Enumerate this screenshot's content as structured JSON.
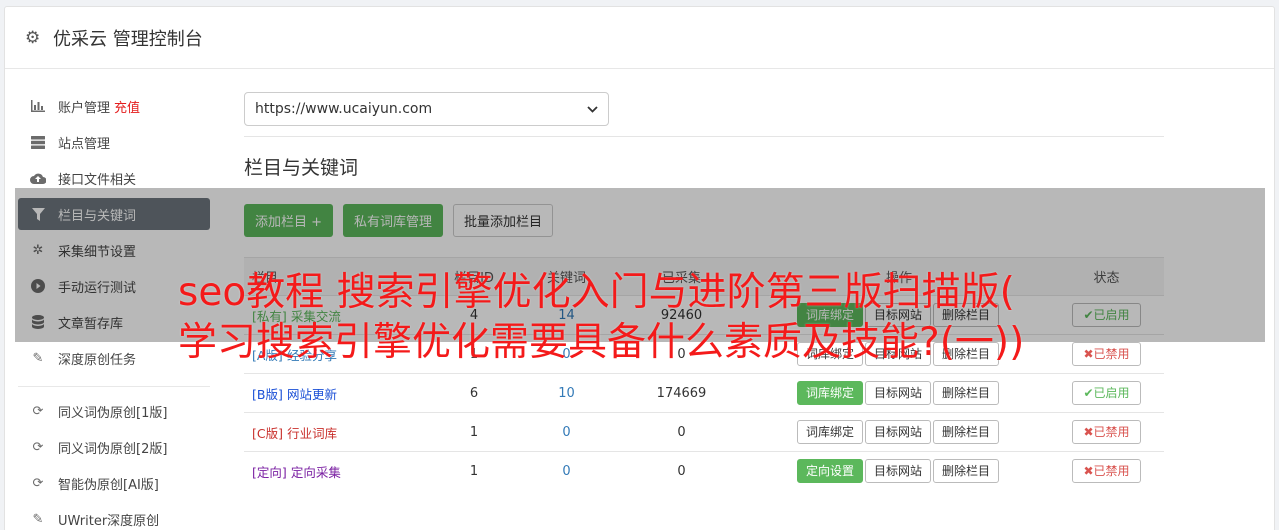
{
  "header": {
    "title": "优采云 管理控制台",
    "icon": "gear-icon"
  },
  "sidebar": {
    "items": [
      {
        "label": "账户管理",
        "extra": "充值",
        "icon": "bar-chart-icon"
      },
      {
        "label": "站点管理",
        "icon": "server-icon"
      },
      {
        "label": "接口文件相关",
        "icon": "cloud-upload-icon"
      },
      {
        "label": "栏目与关键词",
        "icon": "filter-icon",
        "active": true
      },
      {
        "label": "采集细节设置",
        "icon": "gears-icon"
      },
      {
        "label": "手动运行测试",
        "icon": "play-icon"
      },
      {
        "label": "文章暂存库",
        "icon": "database-icon"
      },
      {
        "label": "深度原创任务",
        "icon": "edit-icon"
      }
    ],
    "items2": [
      {
        "label": "同义词伪原创[1版]",
        "icon": "refresh-icon"
      },
      {
        "label": "同义词伪原创[2版]",
        "icon": "refresh-icon"
      },
      {
        "label": "智能伪原创[AI版]",
        "icon": "refresh-icon"
      },
      {
        "label": "UWriter深度原创",
        "icon": "edit-icon"
      }
    ]
  },
  "main": {
    "site_select": "https://www.ucaiyun.com",
    "section_title": "栏目与关键词",
    "toolbar": {
      "add_column": "添加栏目 +",
      "private_lib": "私有词库管理",
      "batch_add": "批量添加栏目"
    },
    "table": {
      "headers": [
        "栏目",
        "栏目ID",
        "关键词",
        "已采集",
        "操作",
        "状态"
      ],
      "rows": [
        {
          "tag": "[私有]",
          "name": "采集交流",
          "tag_color": "#5cb85c",
          "id": "4",
          "kw": "14",
          "count": "92460",
          "bind": "词库绑定",
          "bind_green": true,
          "target": "目标网站",
          "del": "删除栏目",
          "status": "✔已启用",
          "on": true
        },
        {
          "tag": "[A版]",
          "name": "经验分享",
          "tag_color": "#337ab7",
          "id": "1",
          "kw": "0",
          "count": "0",
          "bind": "词库绑定",
          "bind_green": false,
          "target": "目标网站",
          "del": "删除栏目",
          "status": "✖已禁用",
          "on": false
        },
        {
          "tag": "[B版]",
          "name": "网站更新",
          "tag_color": "#1a4fd6",
          "id": "6",
          "kw": "10",
          "count": "174669",
          "bind": "词库绑定",
          "bind_green": true,
          "target": "目标网站",
          "del": "删除栏目",
          "status": "✔已启用",
          "on": true
        },
        {
          "tag": "[C版]",
          "name": "行业词库",
          "tag_color": "#c9302c",
          "id": "1",
          "kw": "0",
          "count": "0",
          "bind": "词库绑定",
          "bind_green": false,
          "target": "目标网站",
          "del": "删除栏目",
          "status": "✖已禁用",
          "on": false
        },
        {
          "tag": "[定向]",
          "name": "定向采集",
          "tag_color": "#7a1fa2",
          "id": "1",
          "kw": "0",
          "count": "0",
          "bind": "定向设置",
          "bind_green": true,
          "target": "目标网站",
          "del": "删除栏目",
          "status": "✖已禁用",
          "on": false
        }
      ]
    }
  },
  "overlay": {
    "headline_line1": "seo教程 搜索引擎优化入门与进阶第三版扫描版(",
    "headline_line2": "学习搜索引擎优化需要具备什么素质及技能?(一))"
  }
}
